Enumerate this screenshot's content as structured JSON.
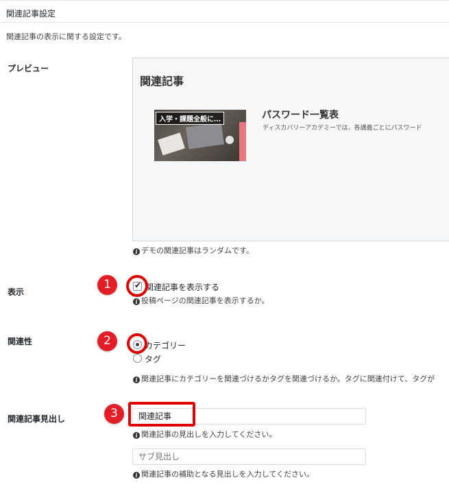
{
  "panel": {
    "title": "関連記事設定",
    "description": "関連記事の表示に関する設定です。"
  },
  "preview": {
    "label": "プレビュー",
    "heading": "関連記事",
    "thumbnail_caption": "入学・課題全般に…",
    "post_title": "パスワード一覧表",
    "post_excerpt": "ディスカバリーアカデミーでは、各講義ごとにパスワード",
    "note": "デモの関連記事はランダムです。"
  },
  "display": {
    "label": "表示",
    "checkbox_label": "関連記事を表示する",
    "checked": true,
    "note": "投稿ページの関連記事を表示するか。"
  },
  "relation": {
    "label": "関連性",
    "options": [
      {
        "label": "カテゴリー",
        "selected": true
      },
      {
        "label": "タグ",
        "selected": false
      }
    ],
    "note": "関連記事にカテゴリーを関連づけるかタグを関連づけるか。タグに関連付けて、タグが"
  },
  "heading_setting": {
    "label": "関連記事見出し",
    "value": "関連記事",
    "note": "関連記事の見出しを入力してください。",
    "sub_placeholder": "サブ見出し",
    "sub_note": "関連記事の補助となる見出しを入力してください。"
  },
  "annotations": {
    "marker1": "1",
    "marker2": "2",
    "marker3": "3",
    "color": "#e41e26"
  },
  "icons": {
    "info": "info-circle-icon",
    "check": "checkmark-icon"
  }
}
